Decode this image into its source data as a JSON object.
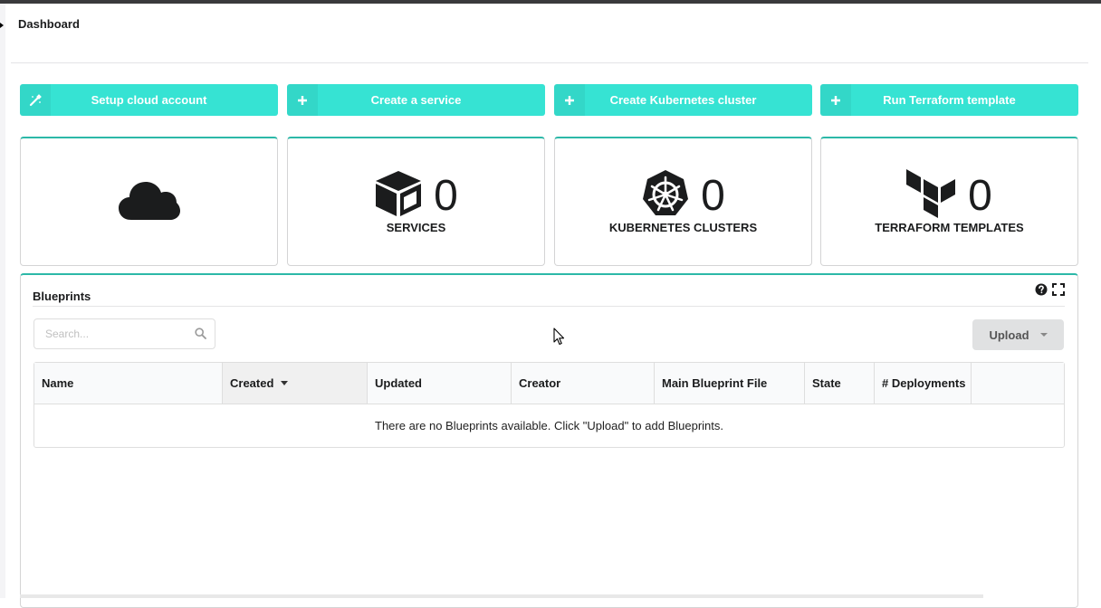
{
  "header": {
    "title": "Dashboard"
  },
  "actions": [
    {
      "label": "Setup cloud account",
      "icon": "magic-wand-icon"
    },
    {
      "label": "Create a service",
      "icon": "plus-icon"
    },
    {
      "label": "Create Kubernetes cluster",
      "icon": "plus-icon"
    },
    {
      "label": "Run Terraform template",
      "icon": "plus-icon"
    }
  ],
  "stats": [
    {
      "icon": "cloud-icon"
    },
    {
      "icon": "cube-icon",
      "value": "0",
      "label": "SERVICES"
    },
    {
      "icon": "kubernetes-icon",
      "value": "0",
      "label": "KUBERNETES CLUSTERS"
    },
    {
      "icon": "terraform-icon",
      "value": "0",
      "label": "TERRAFORM TEMPLATES"
    }
  ],
  "blueprints": {
    "title": "Blueprints",
    "search_placeholder": "Search...",
    "upload_label": "Upload",
    "columns": [
      "Name",
      "Created",
      "Updated",
      "Creator",
      "Main Blueprint File",
      "State",
      "# Deployments",
      ""
    ],
    "sorted_column": "Created",
    "empty_message": "There are no Blueprints available. Click \"Upload\" to add Blueprints."
  },
  "colors": {
    "accent": "#36e3d3",
    "border_accent": "#2cb8a8",
    "upload_bg": "#e0e1e2"
  }
}
